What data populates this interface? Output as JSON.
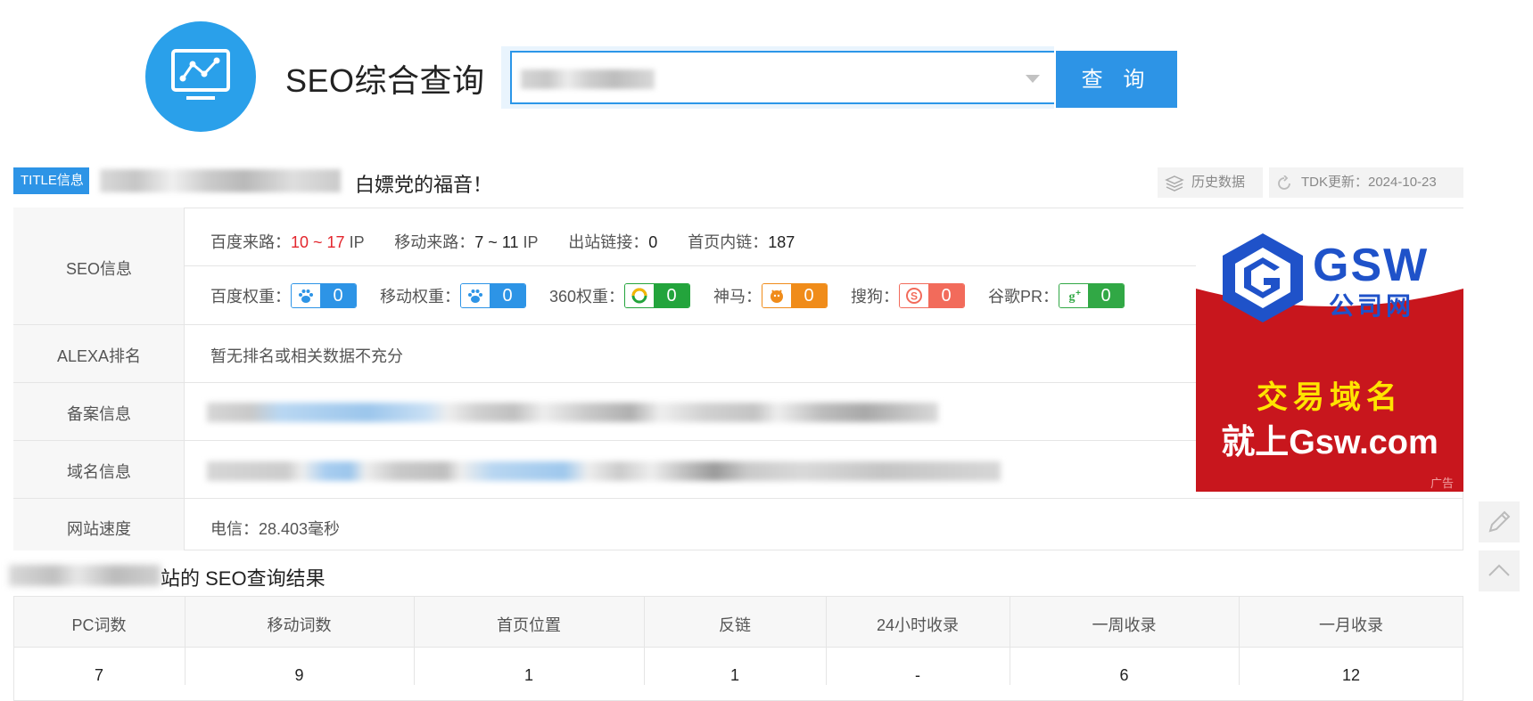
{
  "header": {
    "site_title": "SEO综合查询",
    "search_button": "查 询"
  },
  "title_row": {
    "badge": "TITLE信息",
    "title_suffix": "白嫖党的福音！",
    "history_label": "历史数据",
    "tdk_label": "TDK更新：2024-10-23"
  },
  "seo_info": {
    "label": "SEO信息",
    "baidu_traffic_label": "百度来路：",
    "baidu_traffic_low": "10",
    "baidu_traffic_sep": " ~ ",
    "baidu_traffic_high": "17",
    "ip_unit": " IP",
    "mobile_traffic_label": "移动来路：",
    "mobile_traffic_value": "7 ~ 11",
    "outbound_label": "出站链接：",
    "outbound_value": "0",
    "internal_label": "首页内链：",
    "internal_value": "187",
    "weights": [
      {
        "label": "百度权重：",
        "value": "0",
        "icon": "baidu-paw-icon",
        "color": "#2d94e6"
      },
      {
        "label": "移动权重：",
        "value": "0",
        "icon": "mobile-paw-icon",
        "color": "#2d94e6"
      },
      {
        "label": "360权重：",
        "value": "0",
        "icon": "360-icon",
        "color": "#23a43c"
      },
      {
        "label": "神马：",
        "value": "0",
        "icon": "shenma-icon",
        "color": "#f08c1a"
      },
      {
        "label": "搜狗：",
        "value": "0",
        "icon": "sogou-icon",
        "color": "#f26b5b"
      },
      {
        "label": "谷歌PR：",
        "value": "0",
        "icon": "google-plus-icon",
        "color": "#31a845"
      }
    ]
  },
  "alexa": {
    "label": "ALEXA排名",
    "value": "暂无排名或相关数据不充分"
  },
  "icp": {
    "label": "备案信息"
  },
  "domain": {
    "label": "域名信息"
  },
  "speed": {
    "label": "网站速度",
    "value": "电信：28.403毫秒"
  },
  "ad": {
    "brand": "GSW",
    "brand_cn": "公司网",
    "line1": "交易域名",
    "line2": "就上Gsw.com",
    "tag": "广告"
  },
  "results": {
    "title_suffix": "站的 SEO查询结果",
    "headers": [
      "PC词数",
      "移动词数",
      "首页位置",
      "反链",
      "24小时收录",
      "一周收录",
      "一月收录"
    ],
    "values": [
      "7",
      "9",
      "1",
      "1",
      "-",
      "6",
      "12"
    ]
  },
  "colors": {
    "accent": "#2d94e6",
    "red_value": "#e3262d",
    "ad_red": "#c8161d",
    "ad_yellow": "#ffe400"
  }
}
